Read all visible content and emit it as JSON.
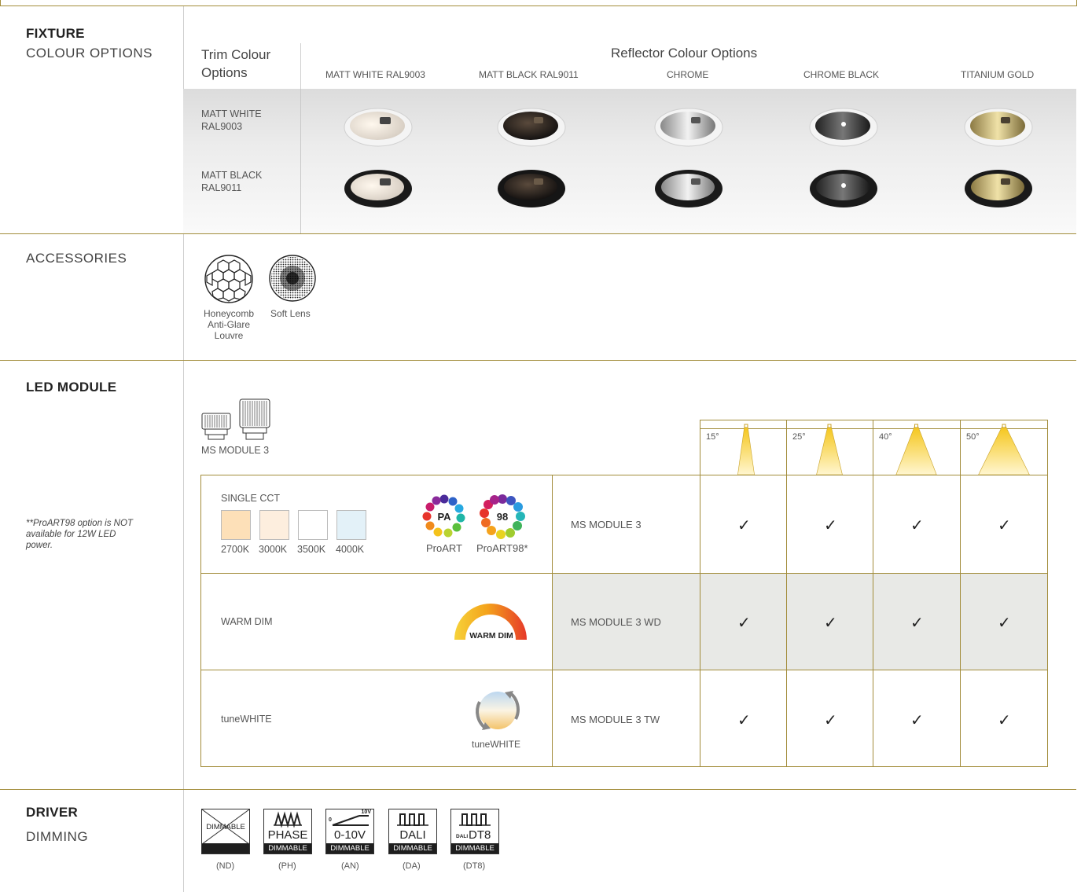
{
  "fixture": {
    "heading_bold": "FIXTURE",
    "heading_light": "COLOUR OPTIONS",
    "trim_header": "Trim Colour Options",
    "trim_header_l1": "Trim Colour",
    "trim_header_l2": "Options",
    "reflector_header": "Reflector Colour Options",
    "reflector_options": [
      "MATT WHITE RAL9003",
      "MATT BLACK RAL9011",
      "CHROME",
      "CHROME BLACK",
      "TITANIUM GOLD"
    ],
    "trim_rows": [
      {
        "l1": "MATT WHITE",
        "l2": "RAL9003"
      },
      {
        "l1": "MATT BLACK",
        "l2": "RAL9011"
      }
    ]
  },
  "accessories": {
    "heading": "ACCESSORIES",
    "items": [
      {
        "label_l1": "Honeycomb",
        "label_l2": "Anti-Glare",
        "label_l3": "Louvre",
        "icon": "honeycomb-icon"
      },
      {
        "label_l1": "Soft Lens",
        "icon": "soft-lens-icon"
      }
    ]
  },
  "led": {
    "heading": "LED MODULE",
    "note": "**ProART98 option is NOT available for 12W LED power.",
    "note_l1": "**ProART98 option is NOT",
    "note_l2": "available for 12W LED",
    "note_l3": "power.",
    "module_label": "MS MODULE 3",
    "beam_angles": [
      "15°",
      "25°",
      "40°",
      "50°"
    ],
    "beam_angle_values": [
      15,
      25,
      40,
      50
    ],
    "single_cct": {
      "title": "SINGLE CCT",
      "ccts": [
        "2700K",
        "3000K",
        "3500K",
        "4000K"
      ],
      "cct_colors": [
        "#fde0b8",
        "#fdeede",
        "#ffffff",
        "#e3f1f8"
      ],
      "proart_label": "ProART",
      "proart_badge": "PA",
      "proart98_label": "ProART98*",
      "proart98_badge": "98",
      "module": "MS MODULE 3"
    },
    "warm_dim": {
      "title": "WARM DIM",
      "badge": "WARM DIM",
      "module": "MS MODULE 3 WD"
    },
    "tune_white": {
      "title": "tuneWHITE",
      "badge": "tuneWHITE",
      "module": "MS MODULE 3 TW"
    },
    "check": "✓"
  },
  "driver": {
    "heading_bold": "DRIVER",
    "heading_light": "DIMMING",
    "options": [
      {
        "top": "DIMMABLE",
        "bar": "",
        "code": "(ND)",
        "icon": "non-dimmable-icon"
      },
      {
        "top": "PHASE",
        "bar": "DIMMABLE",
        "code": "(PH)",
        "icon": "phase-dimming-icon"
      },
      {
        "top": "0-10V",
        "bar": "DIMMABLE",
        "code": "(AN)",
        "icon": "analog-0-10v-icon",
        "small": "10V",
        "zero": "0"
      },
      {
        "top": "DALI",
        "bar": "DIMMABLE",
        "code": "(DA)",
        "icon": "dali-icon"
      },
      {
        "top": "DT8",
        "bar": "DIMMABLE",
        "code": "(DT8)",
        "icon": "dali-dt8-icon",
        "prefix": "DALI"
      }
    ]
  },
  "colors": {
    "gold": "#a28c3a",
    "beam": "#f5c518",
    "grey_cell": "#e8e9e6"
  }
}
